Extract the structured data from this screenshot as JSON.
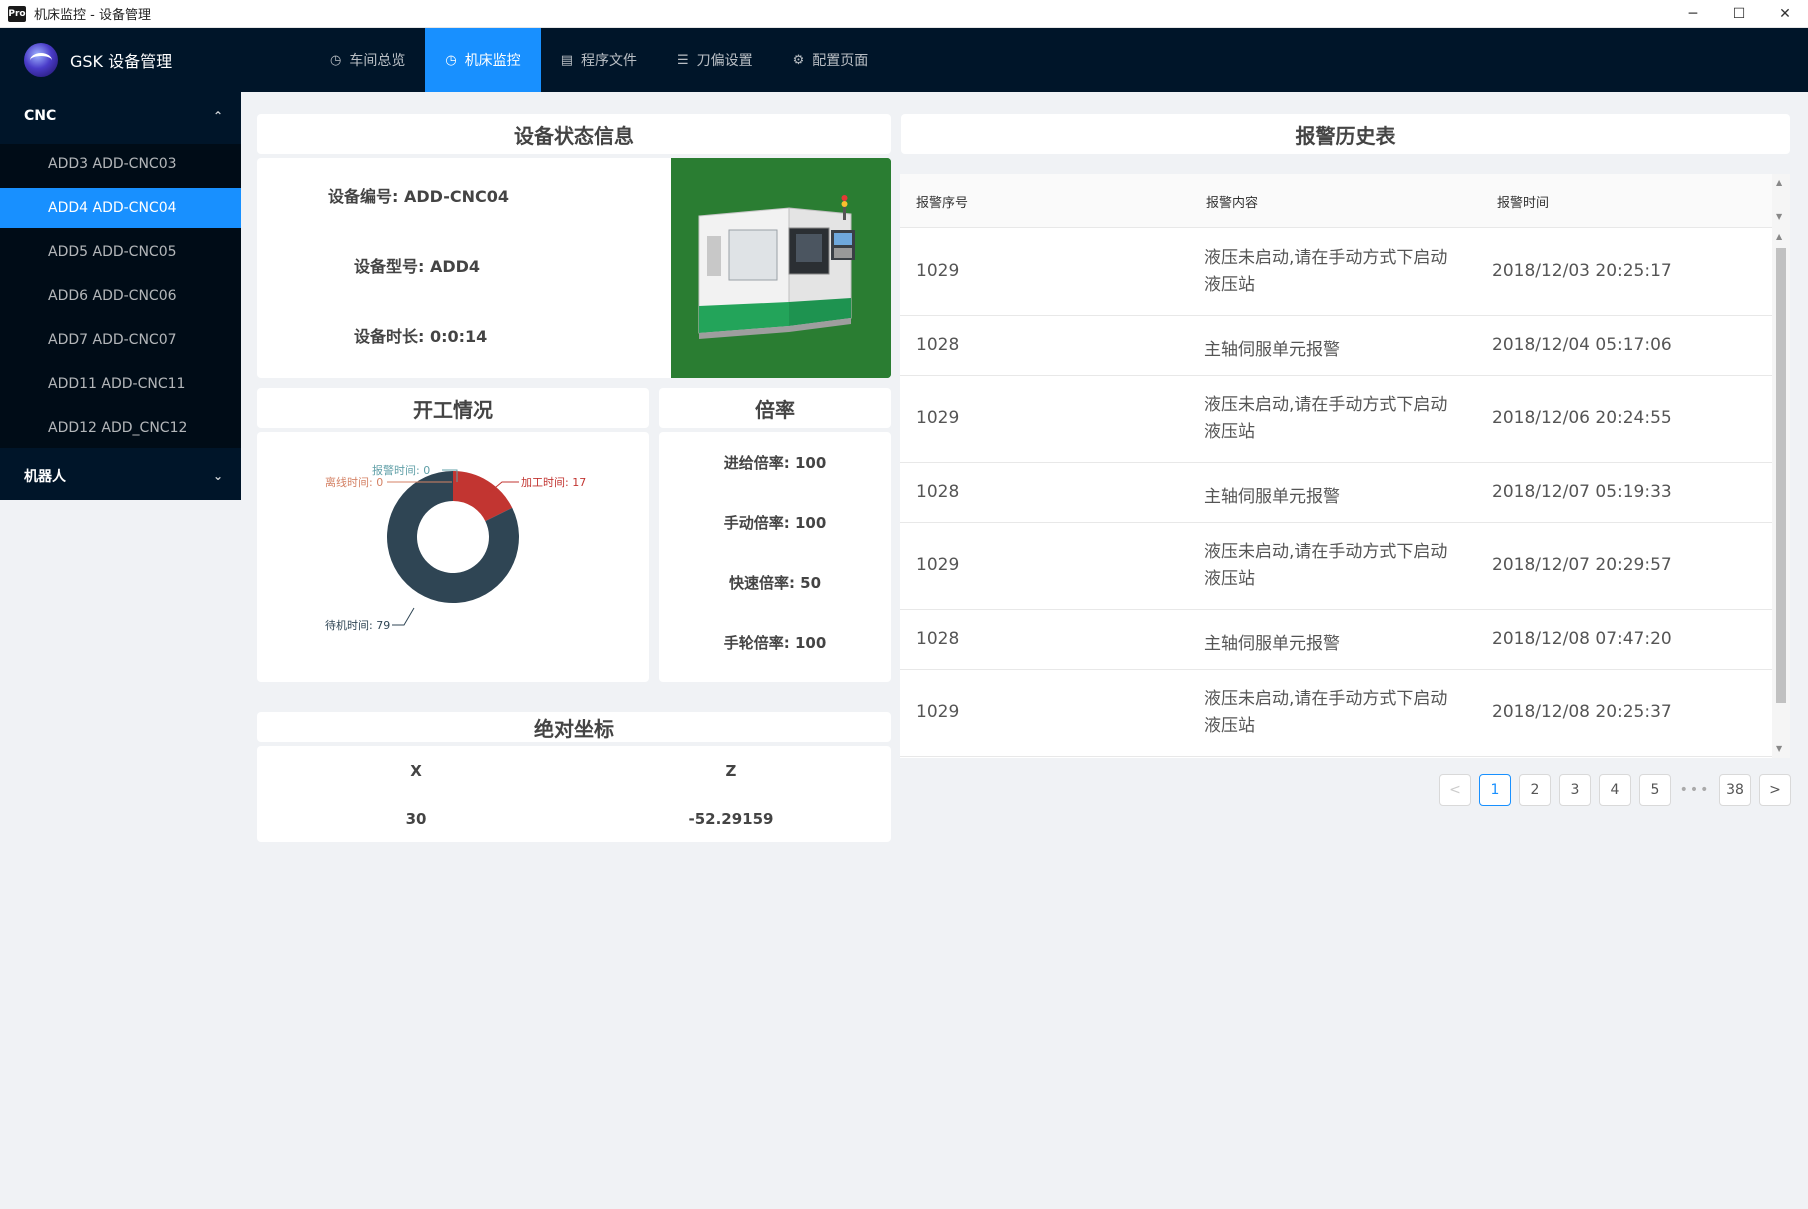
{
  "window": {
    "badge": "Pro",
    "title": "机床监控 - 设备管理",
    "min_icon": "─",
    "max_icon": "☐",
    "close_icon": "✕"
  },
  "navbar": {
    "logo_text": "GSK 设备管理",
    "items": [
      {
        "label": "车间总览",
        "icon": "dashboard-icon",
        "glyph": "◷"
      },
      {
        "label": "机床监控",
        "icon": "dashboard-icon",
        "glyph": "◷"
      },
      {
        "label": "程序文件",
        "icon": "file-icon",
        "glyph": "▤"
      },
      {
        "label": "刀偏设置",
        "icon": "list-icon",
        "glyph": "☰"
      },
      {
        "label": "配置页面",
        "icon": "gear-icon",
        "glyph": "⚙"
      }
    ]
  },
  "sidebar": {
    "group1": {
      "title": "CNC",
      "arrow": "⌃"
    },
    "items": [
      {
        "label": "ADD3 ADD-CNC03"
      },
      {
        "label": "ADD4 ADD-CNC04"
      },
      {
        "label": "ADD5 ADD-CNC05"
      },
      {
        "label": "ADD6 ADD-CNC06"
      },
      {
        "label": "ADD7 ADD-CNC07"
      },
      {
        "label": "ADD11 ADD-CNC11"
      },
      {
        "label": "ADD12 ADD_CNC12"
      }
    ],
    "group2": {
      "title": "机器人",
      "arrow": "⌄"
    }
  },
  "device_status": {
    "title": "设备状态信息",
    "id_label": "设备编号:",
    "id_value": "ADD-CNC04",
    "model_label": "设备型号:",
    "model_value": "ADD4",
    "duration_label": "设备时长:",
    "duration_value": "0:0:14"
  },
  "work": {
    "title": "开工情况"
  },
  "chart_data": {
    "type": "pie",
    "title": "开工情况",
    "slices": [
      {
        "label": "加工时间",
        "value": 17,
        "color": "#c23531"
      },
      {
        "label": "待机时间",
        "value": 79,
        "color": "#2f4554"
      },
      {
        "label": "报警时间",
        "value": 0,
        "color": "#61a0a8"
      },
      {
        "label": "离线时间",
        "value": 0,
        "color": "#d48265"
      }
    ],
    "label_texts": {
      "alarm": "报警时间: 0",
      "offline": "离线时间: 0",
      "process": "加工时间: 17",
      "idle": "待机时间: 79"
    }
  },
  "rates": {
    "title": "倍率",
    "feed_label": "进给倍率:",
    "feed_value": "100",
    "manual_label": "手动倍率:",
    "manual_value": "100",
    "rapid_label": "快速倍率:",
    "rapid_value": "50",
    "wheel_label": "手轮倍率:",
    "wheel_value": "100"
  },
  "coords": {
    "title": "绝对坐标",
    "x_label": "X",
    "x_value": "30",
    "z_label": "Z",
    "z_value": "-52.29159"
  },
  "alarm": {
    "title": "报警历史表",
    "headers": [
      "报警序号",
      "报警内容",
      "报警时间"
    ],
    "rows": [
      {
        "id": "1029",
        "content1": "液压未启动,请在手动方式下启动",
        "content2": "液压站",
        "time": "2018/12/03 20:25:17"
      },
      {
        "id": "1028",
        "content1": "主轴伺服单元报警",
        "content2": "",
        "time": "2018/12/04 05:17:06"
      },
      {
        "id": "1029",
        "content1": "液压未启动,请在手动方式下启动",
        "content2": "液压站",
        "time": "2018/12/06 20:24:55"
      },
      {
        "id": "1028",
        "content1": "主轴伺服单元报警",
        "content2": "",
        "time": "2018/12/07 05:19:33"
      },
      {
        "id": "1029",
        "content1": "液压未启动,请在手动方式下启动",
        "content2": "液压站",
        "time": "2018/12/07 20:29:57"
      },
      {
        "id": "1028",
        "content1": "主轴伺服单元报警",
        "content2": "",
        "time": "2018/12/08 07:47:20"
      },
      {
        "id": "1029",
        "content1": "液压未启动,请在手动方式下启动",
        "content2": "液压站",
        "time": "2018/12/08 20:25:37"
      }
    ]
  },
  "pagination": {
    "prev": "<",
    "pages": [
      "1",
      "2",
      "3",
      "4",
      "5"
    ],
    "ellipsis": "•••",
    "last": "38",
    "next": ">"
  }
}
